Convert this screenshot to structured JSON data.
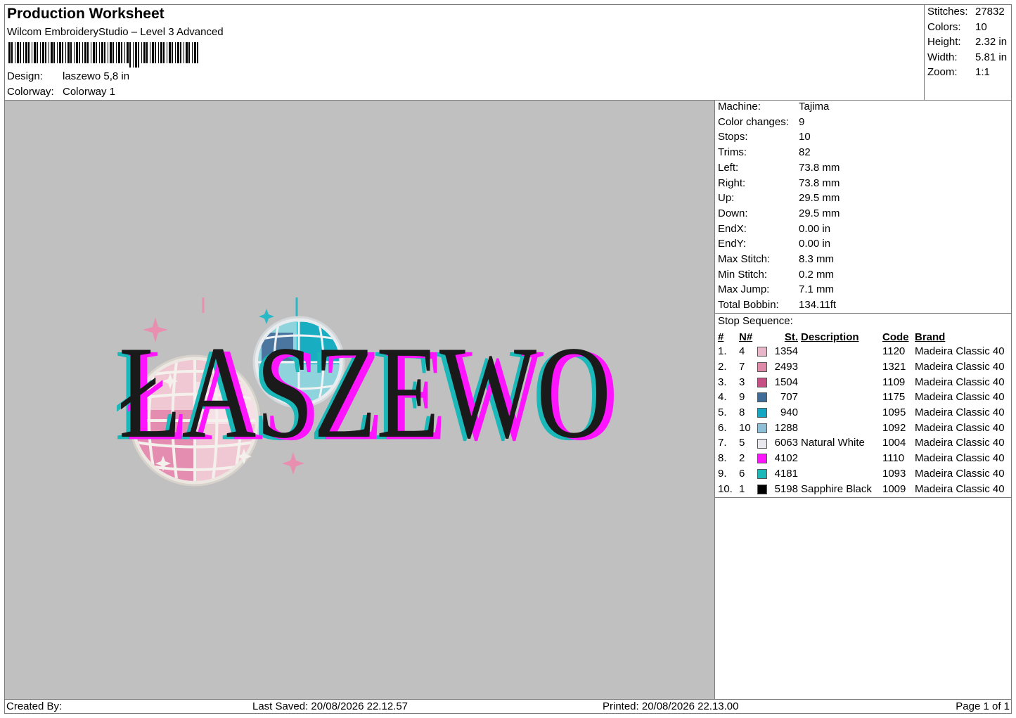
{
  "header": {
    "title": "Production Worksheet",
    "subtitle": "Wilcom EmbroideryStudio – Level 3 Advanced",
    "design_label": "Design:",
    "design_value": "laszewo 5,8 in",
    "colorway_label": "Colorway:",
    "colorway_value": "Colorway 1"
  },
  "stats": [
    {
      "label": "Stitches:",
      "value": "27832"
    },
    {
      "label": "Colors:",
      "value": "10"
    },
    {
      "label": "Height:",
      "value": "2.32 in"
    },
    {
      "label": "Width:",
      "value": "5.81 in"
    },
    {
      "label": "Zoom:",
      "value": "1:1"
    }
  ],
  "design_text": "ŁASZEWO",
  "machine_info": [
    {
      "label": "Machine:",
      "value": "Tajima"
    },
    {
      "label": "Color changes:",
      "value": "9"
    },
    {
      "label": "Stops:",
      "value": "10"
    },
    {
      "label": "Trims:",
      "value": "82"
    },
    {
      "label": "Left:",
      "value": "73.8 mm"
    },
    {
      "label": "Right:",
      "value": "73.8 mm"
    },
    {
      "label": "Up:",
      "value": "29.5 mm"
    },
    {
      "label": "Down:",
      "value": "29.5 mm"
    },
    {
      "label": "EndX:",
      "value": "0.00 in"
    },
    {
      "label": "EndY:",
      "value": "0.00 in"
    },
    {
      "label": "Max Stitch:",
      "value": "8.3 mm"
    },
    {
      "label": "Min Stitch:",
      "value": "0.2 mm"
    },
    {
      "label": "Max Jump:",
      "value": "7.1 mm"
    },
    {
      "label": "Total Bobbin:",
      "value": "134.11ft"
    }
  ],
  "stop_sequence": {
    "title": "Stop Sequence:",
    "columns": [
      "#",
      "N#",
      "St.",
      "Description",
      "Code",
      "Brand"
    ],
    "rows": [
      {
        "num": "1.",
        "n": "4",
        "color": "#e8b6c8",
        "st": "1354",
        "desc": "",
        "code": "1120",
        "brand": "Madeira Classic 40"
      },
      {
        "num": "2.",
        "n": "7",
        "color": "#e08aaa",
        "st": "2493",
        "desc": "",
        "code": "1321",
        "brand": "Madeira Classic 40"
      },
      {
        "num": "3.",
        "n": "3",
        "color": "#c84f84",
        "st": "1504",
        "desc": "",
        "code": "1109",
        "brand": "Madeira Classic 40"
      },
      {
        "num": "4.",
        "n": "9",
        "color": "#3f6d99",
        "st": "707",
        "desc": "",
        "code": "1175",
        "brand": "Madeira Classic 40"
      },
      {
        "num": "5.",
        "n": "8",
        "color": "#14a6c2",
        "st": "940",
        "desc": "",
        "code": "1095",
        "brand": "Madeira Classic 40"
      },
      {
        "num": "6.",
        "n": "10",
        "color": "#8fbfd6",
        "st": "1288",
        "desc": "",
        "code": "1092",
        "brand": "Madeira Classic 40"
      },
      {
        "num": "7.",
        "n": "5",
        "color": "#e9e8ee",
        "st": "6063",
        "desc": "Natural White",
        "code": "1004",
        "brand": "Madeira Classic 40"
      },
      {
        "num": "8.",
        "n": "2",
        "color": "#ff14ff",
        "st": "4102",
        "desc": "",
        "code": "1110",
        "brand": "Madeira Classic 40"
      },
      {
        "num": "9.",
        "n": "6",
        "color": "#1ab8b8",
        "st": "4181",
        "desc": "",
        "code": "1093",
        "brand": "Madeira Classic 40"
      },
      {
        "num": "10.",
        "n": "1",
        "color": "#000000",
        "st": "5198",
        "desc": "Sapphire Black",
        "code": "1009",
        "brand": "Madeira Classic 40"
      }
    ]
  },
  "footer": {
    "created_by": "Created By:",
    "last_saved": "Last Saved: 20/08/2026 22.12.57",
    "printed": "Printed: 20/08/2026 22.13.00",
    "page": "Page 1 of 1"
  }
}
